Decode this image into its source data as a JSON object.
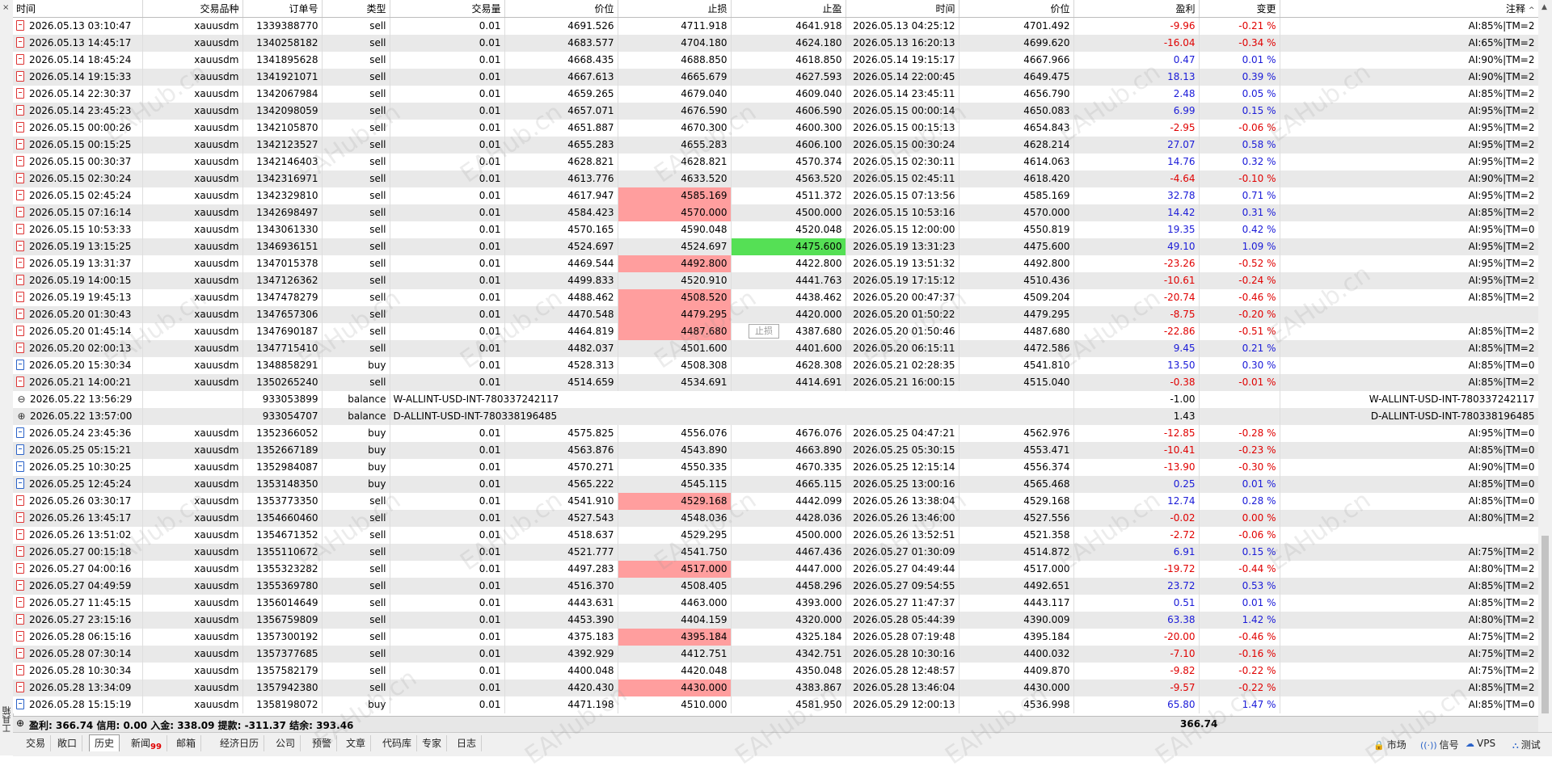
{
  "columns": [
    "时间",
    "交易品种",
    "订单号",
    "类型",
    "交易量",
    "价位",
    "止损",
    "止盈",
    "时间",
    "价位",
    "盈利",
    "变更",
    "注释"
  ],
  "tooltip": "止损",
  "side_label": "工具箱",
  "summary": {
    "text": "盈利: 366.74  信用: 0.00  入金: 338.09  提款: -311.37  结余: 393.46",
    "profit_total": "366.74"
  },
  "tabs": [
    {
      "label": "交易",
      "active": false
    },
    {
      "label": "敞口",
      "active": false
    },
    {
      "label": "历史",
      "active": true
    },
    {
      "label": "新闻",
      "badge": "99",
      "active": false
    },
    {
      "label": "邮箱",
      "active": false
    },
    {
      "label": "经济日历",
      "active": false
    },
    {
      "label": "公司",
      "active": false
    },
    {
      "label": "预警",
      "active": false
    },
    {
      "label": "文章",
      "active": false
    },
    {
      "label": "代码库",
      "active": false
    },
    {
      "label": "专家",
      "active": false
    },
    {
      "label": "日志",
      "active": false
    }
  ],
  "status": [
    {
      "label": "市场",
      "icon": "lock-icon"
    },
    {
      "label": "信号",
      "icon": "signal-icon"
    },
    {
      "label": "VPS",
      "icon": "cloud-icon"
    },
    {
      "label": "测试",
      "icon": "tester-icon"
    }
  ],
  "watermark": "EAHub.cn",
  "rows": [
    {
      "open": "2026.05.13 03:10:47",
      "symbol": "xauusdm",
      "order": "1339388770",
      "type": "sell",
      "vol": "0.01",
      "price": "4691.526",
      "sl": "4711.918",
      "tp": "4641.918",
      "close": "2026.05.13 04:25:12",
      "cprice": "4701.492",
      "profit": "-9.96",
      "change": "-0.21 %",
      "comment": "AI:85%|TM=2"
    },
    {
      "open": "2026.05.13 14:45:17",
      "symbol": "xauusdm",
      "order": "1340258182",
      "type": "sell",
      "vol": "0.01",
      "price": "4683.577",
      "sl": "4704.180",
      "tp": "4624.180",
      "close": "2026.05.13 16:20:13",
      "cprice": "4699.620",
      "profit": "-16.04",
      "change": "-0.34 %",
      "comment": "AI:65%|TM=2"
    },
    {
      "open": "2026.05.14 18:45:24",
      "symbol": "xauusdm",
      "order": "1341895628",
      "type": "sell",
      "vol": "0.01",
      "price": "4668.435",
      "sl": "4688.850",
      "tp": "4618.850",
      "close": "2026.05.14 19:15:17",
      "cprice": "4667.966",
      "profit": "0.47",
      "change": "0.01 %",
      "comment": "AI:90%|TM=2"
    },
    {
      "open": "2026.05.14 19:15:33",
      "symbol": "xauusdm",
      "order": "1341921071",
      "type": "sell",
      "vol": "0.01",
      "price": "4667.613",
      "sl": "4665.679",
      "tp": "4627.593",
      "close": "2026.05.14 22:00:45",
      "cprice": "4649.475",
      "profit": "18.13",
      "change": "0.39 %",
      "comment": "AI:90%|TM=2"
    },
    {
      "open": "2026.05.14 22:30:37",
      "symbol": "xauusdm",
      "order": "1342067984",
      "type": "sell",
      "vol": "0.01",
      "price": "4659.265",
      "sl": "4679.040",
      "tp": "4609.040",
      "close": "2026.05.14 23:45:11",
      "cprice": "4656.790",
      "profit": "2.48",
      "change": "0.05 %",
      "comment": "AI:85%|TM=2"
    },
    {
      "open": "2026.05.14 23:45:23",
      "symbol": "xauusdm",
      "order": "1342098059",
      "type": "sell",
      "vol": "0.01",
      "price": "4657.071",
      "sl": "4676.590",
      "tp": "4606.590",
      "close": "2026.05.15 00:00:14",
      "cprice": "4650.083",
      "profit": "6.99",
      "change": "0.15 %",
      "comment": "AI:95%|TM=2"
    },
    {
      "open": "2026.05.15 00:00:26",
      "symbol": "xauusdm",
      "order": "1342105870",
      "type": "sell",
      "vol": "0.01",
      "price": "4651.887",
      "sl": "4670.300",
      "tp": "4600.300",
      "close": "2026.05.15 00:15:13",
      "cprice": "4654.843",
      "profit": "-2.95",
      "change": "-0.06 %",
      "comment": "AI:95%|TM=2"
    },
    {
      "open": "2026.05.15 00:15:25",
      "symbol": "xauusdm",
      "order": "1342123527",
      "type": "sell",
      "vol": "0.01",
      "price": "4655.283",
      "sl": "4655.283",
      "tp": "4606.100",
      "close": "2026.05.15 00:30:24",
      "cprice": "4628.214",
      "profit": "27.07",
      "change": "0.58 %",
      "comment": "AI:95%|TM=2"
    },
    {
      "open": "2026.05.15 00:30:37",
      "symbol": "xauusdm",
      "order": "1342146403",
      "type": "sell",
      "vol": "0.01",
      "price": "4628.821",
      "sl": "4628.821",
      "tp": "4570.374",
      "close": "2026.05.15 02:30:11",
      "cprice": "4614.063",
      "profit": "14.76",
      "change": "0.32 %",
      "comment": "AI:95%|TM=2"
    },
    {
      "open": "2026.05.15 02:30:24",
      "symbol": "xauusdm",
      "order": "1342316971",
      "type": "sell",
      "vol": "0.01",
      "price": "4613.776",
      "sl": "4633.520",
      "tp": "4563.520",
      "close": "2026.05.15 02:45:11",
      "cprice": "4618.420",
      "profit": "-4.64",
      "change": "-0.10 %",
      "comment": "AI:90%|TM=2"
    },
    {
      "open": "2026.05.15 02:45:24",
      "symbol": "xauusdm",
      "order": "1342329810",
      "type": "sell",
      "vol": "0.01",
      "price": "4617.947",
      "sl": "4585.169",
      "sl_hl": "red",
      "tp": "4511.372",
      "close": "2026.05.15 07:13:56",
      "cprice": "4585.169",
      "profit": "32.78",
      "change": "0.71 %",
      "comment": "AI:95%|TM=2"
    },
    {
      "open": "2026.05.15 07:16:14",
      "symbol": "xauusdm",
      "order": "1342698497",
      "type": "sell",
      "vol": "0.01",
      "price": "4584.423",
      "sl": "4570.000",
      "sl_hl": "red",
      "tp": "4500.000",
      "close": "2026.05.15 10:53:16",
      "cprice": "4570.000",
      "profit": "14.42",
      "change": "0.31 %",
      "comment": "AI:85%|TM=2"
    },
    {
      "open": "2026.05.15 10:53:33",
      "symbol": "xauusdm",
      "order": "1343061330",
      "type": "sell",
      "vol": "0.01",
      "price": "4570.165",
      "sl": "4590.048",
      "tp": "4520.048",
      "close": "2026.05.15 12:00:00",
      "cprice": "4550.819",
      "profit": "19.35",
      "change": "0.42 %",
      "comment": "AI:95%|TM=0"
    },
    {
      "open": "2026.05.19 13:15:25",
      "symbol": "xauusdm",
      "order": "1346936151",
      "type": "sell",
      "vol": "0.01",
      "price": "4524.697",
      "sl": "4524.697",
      "tp": "4475.600",
      "tp_hl": "green",
      "close": "2026.05.19 13:31:23",
      "cprice": "4475.600",
      "profit": "49.10",
      "change": "1.09 %",
      "comment": "AI:95%|TM=2"
    },
    {
      "open": "2026.05.19 13:31:37",
      "symbol": "xauusdm",
      "order": "1347015378",
      "type": "sell",
      "vol": "0.01",
      "price": "4469.544",
      "sl": "4492.800",
      "sl_hl": "red",
      "tp": "4422.800",
      "close": "2026.05.19 13:51:32",
      "cprice": "4492.800",
      "profit": "-23.26",
      "change": "-0.52 %",
      "comment": "AI:95%|TM=2"
    },
    {
      "open": "2026.05.19 14:00:15",
      "symbol": "xauusdm",
      "order": "1347126362",
      "type": "sell",
      "vol": "0.01",
      "price": "4499.833",
      "sl": "4520.910",
      "tp": "4441.763",
      "close": "2026.05.19 17:15:12",
      "cprice": "4510.436",
      "profit": "-10.61",
      "change": "-0.24 %",
      "comment": "AI:95%|TM=2"
    },
    {
      "open": "2026.05.19 19:45:13",
      "symbol": "xauusdm",
      "order": "1347478279",
      "type": "sell",
      "vol": "0.01",
      "price": "4488.462",
      "sl": "4508.520",
      "sl_hl": "red",
      "tp": "4438.462",
      "close": "2026.05.20 00:47:37",
      "cprice": "4509.204",
      "profit": "-20.74",
      "change": "-0.46 %",
      "comment": "AI:85%|TM=2"
    },
    {
      "open": "2026.05.20 01:30:43",
      "symbol": "xauusdm",
      "order": "1347657306",
      "type": "sell",
      "vol": "0.01",
      "price": "4470.548",
      "sl": "4479.295",
      "sl_hl": "red",
      "tp": "4420.000",
      "close": "2026.05.20 01:50:22",
      "cprice": "4479.295",
      "profit": "-8.75",
      "change": "-0.20 %",
      "comment": ""
    },
    {
      "open": "2026.05.20 01:45:14",
      "symbol": "xauusdm",
      "order": "1347690187",
      "type": "sell",
      "vol": "0.01",
      "price": "4464.819",
      "sl": "4487.680",
      "sl_hl": "red",
      "tp": "4387.680",
      "close": "2026.05.20 01:50:46",
      "cprice": "4487.680",
      "profit": "-22.86",
      "change": "-0.51 %",
      "comment": "AI:85%|TM=2"
    },
    {
      "open": "2026.05.20 02:00:13",
      "symbol": "xauusdm",
      "order": "1347715410",
      "type": "sell",
      "vol": "0.01",
      "price": "4482.037",
      "sl": "4501.600",
      "tp": "4401.600",
      "close": "2026.05.20 06:15:11",
      "cprice": "4472.586",
      "profit": "9.45",
      "change": "0.21 %",
      "comment": "AI:85%|TM=2"
    },
    {
      "open": "2026.05.20 15:30:34",
      "symbol": "xauusdm",
      "order": "1348858291",
      "type": "buy",
      "vol": "0.01",
      "price": "4528.313",
      "sl": "4508.308",
      "tp": "4628.308",
      "close": "2026.05.21 02:28:35",
      "cprice": "4541.810",
      "profit": "13.50",
      "change": "0.30 %",
      "comment": "AI:85%|TM=0"
    },
    {
      "open": "2026.05.21 14:00:21",
      "symbol": "xauusdm",
      "order": "1350265240",
      "type": "sell",
      "vol": "0.01",
      "price": "4514.659",
      "sl": "4534.691",
      "tp": "4414.691",
      "close": "2026.05.21 16:00:15",
      "cprice": "4515.040",
      "profit": "-0.38",
      "change": "-0.01 %",
      "comment": "AI:85%|TM=2"
    },
    {
      "balance": true,
      "sign": "minus",
      "open": "2026.05.22 13:56:29",
      "order": "933053899",
      "type": "balance",
      "desc": "W-ALLINT-USD-INT-780337242117",
      "profit": "-1.00",
      "comment": "W-ALLINT-USD-INT-780337242117"
    },
    {
      "balance": true,
      "sign": "plus",
      "open": "2026.05.22 13:57:00",
      "order": "933054707",
      "type": "balance",
      "desc": "D-ALLINT-USD-INT-780338196485",
      "profit": "1.43",
      "comment": "D-ALLINT-USD-INT-780338196485"
    },
    {
      "open": "2026.05.24 23:45:36",
      "symbol": "xauusdm",
      "order": "1352366052",
      "type": "buy",
      "vol": "0.01",
      "price": "4575.825",
      "sl": "4556.076",
      "tp": "4676.076",
      "close": "2026.05.25 04:47:21",
      "cprice": "4562.976",
      "profit": "-12.85",
      "change": "-0.28 %",
      "comment": "AI:95%|TM=0"
    },
    {
      "open": "2026.05.25 05:15:21",
      "symbol": "xauusdm",
      "order": "1352667189",
      "type": "buy",
      "vol": "0.01",
      "price": "4563.876",
      "sl": "4543.890",
      "tp": "4663.890",
      "close": "2026.05.25 05:30:15",
      "cprice": "4553.471",
      "profit": "-10.41",
      "change": "-0.23 %",
      "comment": "AI:85%|TM=0"
    },
    {
      "open": "2026.05.25 10:30:25",
      "symbol": "xauusdm",
      "order": "1352984087",
      "type": "buy",
      "vol": "0.01",
      "price": "4570.271",
      "sl": "4550.335",
      "tp": "4670.335",
      "close": "2026.05.25 12:15:14",
      "cprice": "4556.374",
      "profit": "-13.90",
      "change": "-0.30 %",
      "comment": "AI:90%|TM=0"
    },
    {
      "open": "2026.05.25 12:45:24",
      "symbol": "xauusdm",
      "order": "1353148350",
      "type": "buy",
      "vol": "0.01",
      "price": "4565.222",
      "sl": "4545.115",
      "tp": "4665.115",
      "close": "2026.05.25 13:00:16",
      "cprice": "4565.468",
      "profit": "0.25",
      "change": "0.01 %",
      "comment": "AI:85%|TM=0"
    },
    {
      "open": "2026.05.26 03:30:17",
      "symbol": "xauusdm",
      "order": "1353773350",
      "type": "sell",
      "vol": "0.01",
      "price": "4541.910",
      "sl": "4529.168",
      "sl_hl": "red",
      "tp": "4442.099",
      "close": "2026.05.26 13:38:04",
      "cprice": "4529.168",
      "profit": "12.74",
      "change": "0.28 %",
      "comment": "AI:85%|TM=0"
    },
    {
      "open": "2026.05.26 13:45:17",
      "symbol": "xauusdm",
      "order": "1354660460",
      "type": "sell",
      "vol": "0.01",
      "price": "4527.543",
      "sl": "4548.036",
      "tp": "4428.036",
      "close": "2026.05.26 13:46:00",
      "cprice": "4527.556",
      "profit": "-0.02",
      "change": "0.00 %",
      "comment": "AI:80%|TM=2"
    },
    {
      "open": "2026.05.26 13:51:02",
      "symbol": "xauusdm",
      "order": "1354671352",
      "type": "sell",
      "vol": "0.01",
      "price": "4518.637",
      "sl": "4529.295",
      "tp": "4500.000",
      "close": "2026.05.26 13:52:51",
      "cprice": "4521.358",
      "profit": "-2.72",
      "change": "-0.06 %",
      "comment": ""
    },
    {
      "open": "2026.05.27 00:15:18",
      "symbol": "xauusdm",
      "order": "1355110672",
      "type": "sell",
      "vol": "0.01",
      "price": "4521.777",
      "sl": "4541.750",
      "tp": "4467.436",
      "close": "2026.05.27 01:30:09",
      "cprice": "4514.872",
      "profit": "6.91",
      "change": "0.15 %",
      "comment": "AI:75%|TM=2"
    },
    {
      "open": "2026.05.27 04:00:16",
      "symbol": "xauusdm",
      "order": "1355323282",
      "type": "sell",
      "vol": "0.01",
      "price": "4497.283",
      "sl": "4517.000",
      "sl_hl": "red",
      "tp": "4447.000",
      "close": "2026.05.27 04:49:44",
      "cprice": "4517.000",
      "profit": "-19.72",
      "change": "-0.44 %",
      "comment": "AI:80%|TM=2"
    },
    {
      "open": "2026.05.27 04:49:59",
      "symbol": "xauusdm",
      "order": "1355369780",
      "type": "sell",
      "vol": "0.01",
      "price": "4516.370",
      "sl": "4508.405",
      "tp": "4458.296",
      "close": "2026.05.27 09:54:55",
      "cprice": "4492.651",
      "profit": "23.72",
      "change": "0.53 %",
      "comment": "AI:85%|TM=2"
    },
    {
      "open": "2026.05.27 11:45:15",
      "symbol": "xauusdm",
      "order": "1356014649",
      "type": "sell",
      "vol": "0.01",
      "price": "4443.631",
      "sl": "4463.000",
      "tp": "4393.000",
      "close": "2026.05.27 11:47:37",
      "cprice": "4443.117",
      "profit": "0.51",
      "change": "0.01 %",
      "comment": "AI:85%|TM=2"
    },
    {
      "open": "2026.05.27 23:15:16",
      "symbol": "xauusdm",
      "order": "1356759809",
      "type": "sell",
      "vol": "0.01",
      "price": "4453.390",
      "sl": "4404.159",
      "tp": "4320.000",
      "close": "2026.05.28 05:44:39",
      "cprice": "4390.009",
      "profit": "63.38",
      "change": "1.42 %",
      "comment": "AI:80%|TM=2"
    },
    {
      "open": "2026.05.28 06:15:16",
      "symbol": "xauusdm",
      "order": "1357300192",
      "type": "sell",
      "vol": "0.01",
      "price": "4375.183",
      "sl": "4395.184",
      "sl_hl": "red",
      "tp": "4325.184",
      "close": "2026.05.28 07:19:48",
      "cprice": "4395.184",
      "profit": "-20.00",
      "change": "-0.46 %",
      "comment": "AI:75%|TM=2"
    },
    {
      "open": "2026.05.28 07:30:14",
      "symbol": "xauusdm",
      "order": "1357377685",
      "type": "sell",
      "vol": "0.01",
      "price": "4392.929",
      "sl": "4412.751",
      "tp": "4342.751",
      "close": "2026.05.28 10:30:16",
      "cprice": "4400.032",
      "profit": "-7.10",
      "change": "-0.16 %",
      "comment": "AI:75%|TM=2"
    },
    {
      "open": "2026.05.28 10:30:34",
      "symbol": "xauusdm",
      "order": "1357582179",
      "type": "sell",
      "vol": "0.01",
      "price": "4400.048",
      "sl": "4420.048",
      "tp": "4350.048",
      "close": "2026.05.28 12:48:57",
      "cprice": "4409.870",
      "profit": "-9.82",
      "change": "-0.22 %",
      "comment": "AI:75%|TM=2"
    },
    {
      "open": "2026.05.28 13:34:09",
      "symbol": "xauusdm",
      "order": "1357942380",
      "type": "sell",
      "vol": "0.01",
      "price": "4420.430",
      "sl": "4430.000",
      "sl_hl": "red",
      "tp": "4383.867",
      "close": "2026.05.28 13:46:04",
      "cprice": "4430.000",
      "profit": "-9.57",
      "change": "-0.22 %",
      "comment": "AI:85%|TM=2"
    },
    {
      "open": "2026.05.28 15:15:19",
      "symbol": "xauusdm",
      "order": "1358198072",
      "type": "buy",
      "vol": "0.01",
      "price": "4471.198",
      "sl": "4510.000",
      "tp": "4581.950",
      "close": "2026.05.29 12:00:13",
      "cprice": "4536.998",
      "profit": "65.80",
      "change": "1.47 %",
      "comment": "AI:85%|TM=0"
    }
  ]
}
